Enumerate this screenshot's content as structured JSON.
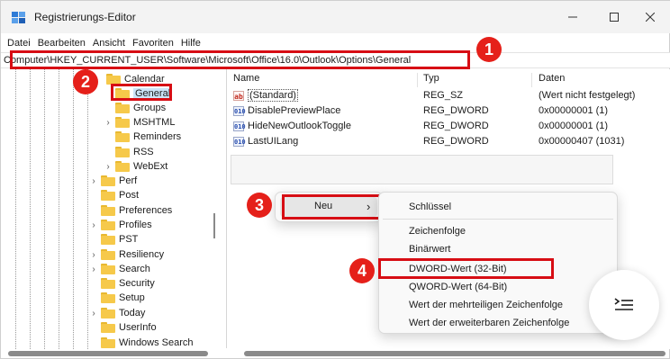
{
  "window": {
    "title": "Registrierungs-Editor",
    "controls": {
      "minimize": "minimize-icon",
      "maximize": "maximize-icon",
      "close": "close-icon"
    }
  },
  "menu": [
    "Datei",
    "Bearbeiten",
    "Ansicht",
    "Favoriten",
    "Hilfe"
  ],
  "address": "Computer\\HKEY_CURRENT_USER\\Software\\Microsoft\\Office\\16.0\\Outlook\\Options\\General",
  "badges": [
    "1",
    "2",
    "3",
    "4"
  ],
  "tree": {
    "items": [
      {
        "label": "Calendar",
        "expandable": false,
        "level": 2
      },
      {
        "label": "General",
        "expandable": false,
        "level": 2,
        "selected": true
      },
      {
        "label": "Groups",
        "expandable": false,
        "level": 2
      },
      {
        "label": "MSHTML",
        "expandable": true,
        "level": 2
      },
      {
        "label": "Reminders",
        "expandable": false,
        "level": 2
      },
      {
        "label": "RSS",
        "expandable": false,
        "level": 2
      },
      {
        "label": "WebExt",
        "expandable": true,
        "level": 2
      },
      {
        "label": "Perf",
        "expandable": true,
        "level": 1
      },
      {
        "label": "Post",
        "expandable": false,
        "level": 1
      },
      {
        "label": "Preferences",
        "expandable": false,
        "level": 1
      },
      {
        "label": "Profiles",
        "expandable": true,
        "level": 1
      },
      {
        "label": "PST",
        "expandable": false,
        "level": 1
      },
      {
        "label": "Resiliency",
        "expandable": true,
        "level": 1
      },
      {
        "label": "Search",
        "expandable": true,
        "level": 1
      },
      {
        "label": "Security",
        "expandable": false,
        "level": 1
      },
      {
        "label": "Setup",
        "expandable": false,
        "level": 1
      },
      {
        "label": "Today",
        "expandable": true,
        "level": 1
      },
      {
        "label": "UserInfo",
        "expandable": false,
        "level": 1
      },
      {
        "label": "Windows Search",
        "expandable": false,
        "level": 1
      }
    ]
  },
  "list": {
    "headers": {
      "name": "Name",
      "type": "Typ",
      "data": "Daten"
    },
    "rows": [
      {
        "icon": "ab",
        "name": "(Standard)",
        "type": "REG_SZ",
        "data": "(Wert nicht festgelegt)"
      },
      {
        "icon": "dword",
        "name": "DisablePreviewPlace",
        "type": "REG_DWORD",
        "data": "0x00000001 (1)"
      },
      {
        "icon": "dword",
        "name": "HideNewOutlookToggle",
        "type": "REG_DWORD",
        "data": "0x00000001 (1)"
      },
      {
        "icon": "dword",
        "name": "LastUILang",
        "type": "REG_DWORD",
        "data": "0x00000407 (1031)"
      }
    ],
    "icon_text": {
      "ab": "ab",
      "dword": "010"
    }
  },
  "context_menu": {
    "item": "Neu",
    "arrow": "›"
  },
  "submenu": {
    "items": [
      "Schlüssel",
      "Zeichenfolge",
      "Binärwert",
      "DWORD-Wert (32-Bit)",
      "QWORD-Wert (64-Bit)",
      "Wert der mehrteiligen Zeichenfolge",
      "Wert der erweiterbaren Zeichenfolge"
    ]
  },
  "colors": {
    "highlight": "#d70d14",
    "badge": "#e5201a",
    "selection": "#cce4f7"
  }
}
